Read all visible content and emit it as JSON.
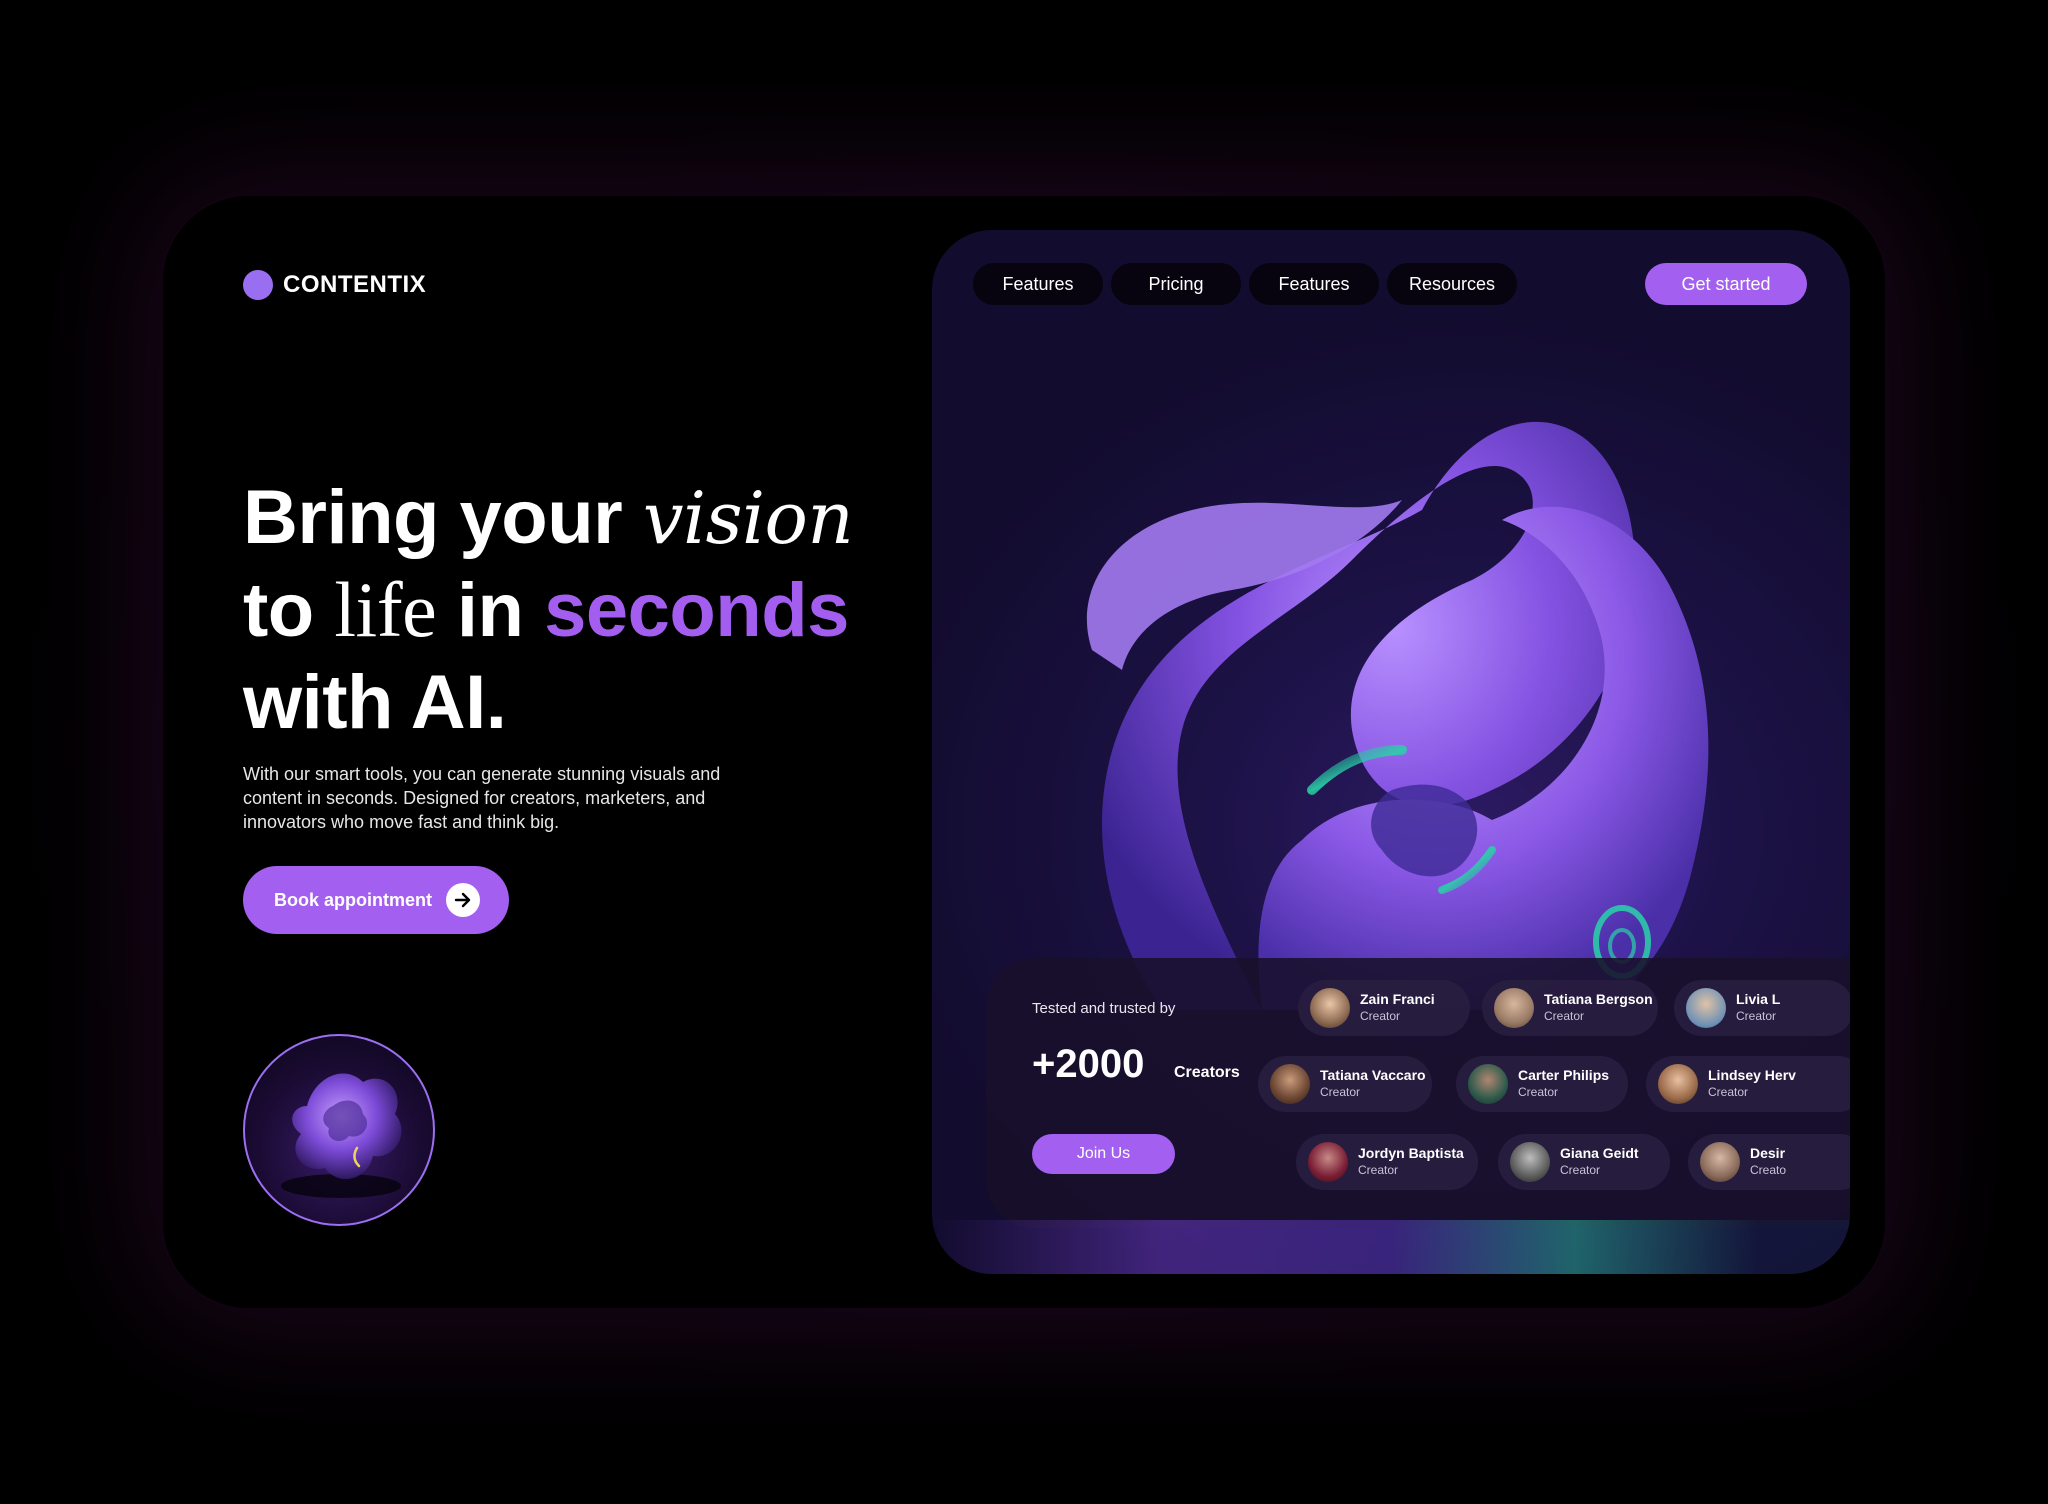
{
  "brand": {
    "name": "CONTENTIX",
    "accent": "#a25ff0"
  },
  "hero": {
    "line1_a": "Bring your ",
    "line1_b": "vision",
    "line2_a": "to ",
    "line2_b": "life",
    "line2_c": " in ",
    "line2_d": "seconds",
    "line3": "with AI.",
    "subtext": "With our smart tools, you can generate stunning visuals and content in seconds. Designed for creators, marketers, and innovators who move fast and think big.",
    "cta_label": "Book appointment",
    "cta_icon": "arrow-right-icon"
  },
  "nav": {
    "items": [
      {
        "label": "Features"
      },
      {
        "label": "Pricing"
      },
      {
        "label": "Features"
      },
      {
        "label": "Resources"
      }
    ],
    "get_started": "Get started"
  },
  "trust": {
    "title": "Tested and trusted by",
    "count": "+2000",
    "count_label": "Creators",
    "join_label": "Join Us",
    "people": [
      {
        "name": "Zain Franci",
        "role": "Creator"
      },
      {
        "name": "Tatiana Bergson",
        "role": "Creator"
      },
      {
        "name": "Livia L",
        "role": "Creator"
      },
      {
        "name": "Tatiana Vaccaro",
        "role": "Creator"
      },
      {
        "name": "Carter Philips",
        "role": "Creator"
      },
      {
        "name": "Lindsey Herv",
        "role": "Creator"
      },
      {
        "name": "Jordyn Baptista",
        "role": "Creator"
      },
      {
        "name": "Giana Geidt",
        "role": "Creator"
      },
      {
        "name": "Desir",
        "role": "Creato"
      }
    ]
  }
}
